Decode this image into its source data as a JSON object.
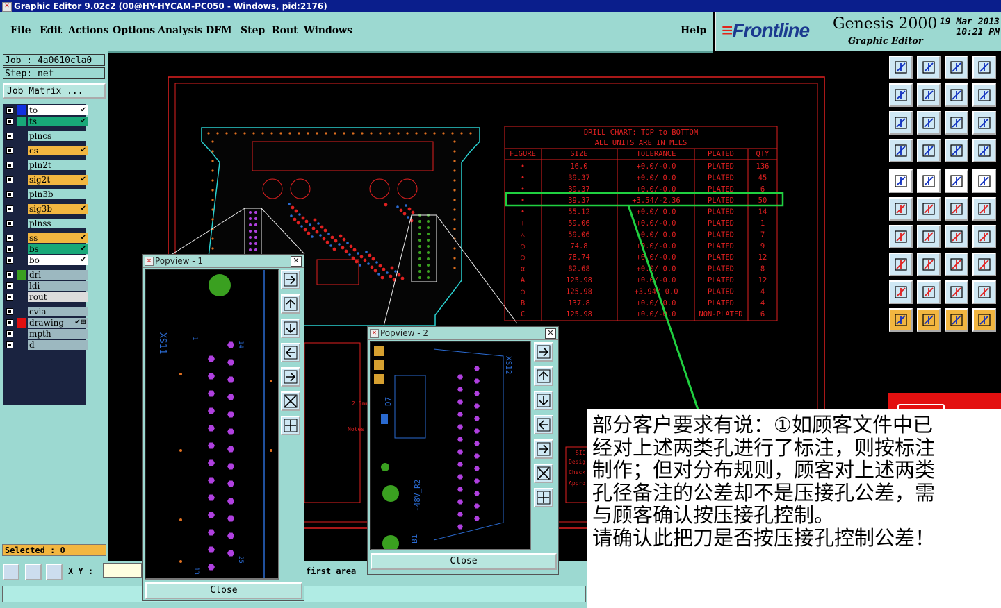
{
  "window": {
    "title": "Graphic Editor 9.02c2 (00@HY-HYCAM-PC050 - Windows, pid:2176)"
  },
  "menu": {
    "items": [
      "File",
      "Edit",
      "Actions",
      "Options",
      "Analysis",
      "DFM",
      "Step",
      "Rout",
      "Windows"
    ],
    "help": "Help"
  },
  "brand": {
    "logo": "Frontline",
    "product": "Genesis 2000",
    "subtitle": "Graphic Editor",
    "date": "19 Mar 2013",
    "time": "10:21 PM"
  },
  "job": {
    "job_label": "Job : 4a0610cla0",
    "step_label": "Step: net",
    "matrix_button": "Job Matrix ..."
  },
  "layers": [
    {
      "name": "to",
      "swatch": "#1030e0",
      "bg": "#ffffff",
      "mark": "✔"
    },
    {
      "name": "ts",
      "swatch": "#18a878",
      "bg": "#18a878",
      "mark": "✔"
    },
    {
      "name": "plncs",
      "swatch": "",
      "bg": "#9cd9d1",
      "mark": ""
    },
    {
      "name": "cs",
      "swatch": "",
      "bg": "#f2b640",
      "mark": "✔"
    },
    {
      "name": "pln2t",
      "swatch": "",
      "bg": "#9cd9d1",
      "mark": ""
    },
    {
      "name": "sig2t",
      "swatch": "",
      "bg": "#f2b640",
      "mark": "✔"
    },
    {
      "name": "pln3b",
      "swatch": "",
      "bg": "#9cd9d1",
      "mark": ""
    },
    {
      "name": "sig3b",
      "swatch": "",
      "bg": "#f2b640",
      "mark": "✔"
    },
    {
      "name": "plnss",
      "swatch": "",
      "bg": "#9cd9d1",
      "mark": ""
    },
    {
      "name": "ss",
      "swatch": "",
      "bg": "#f2b640",
      "mark": "✔"
    },
    {
      "name": "bs",
      "swatch": "",
      "bg": "#18a878",
      "mark": "✔"
    },
    {
      "name": "bo",
      "swatch": "",
      "bg": "#ffffff",
      "mark": "✔"
    },
    {
      "name": "drl",
      "swatch": "#3aa020",
      "bg": "#9cb8c0",
      "mark": ""
    },
    {
      "name": "ldi",
      "swatch": "",
      "bg": "#9cb8c0",
      "mark": ""
    },
    {
      "name": "rout",
      "swatch": "",
      "bg": "#dcdcdc",
      "mark": ""
    },
    {
      "name": "cvia",
      "swatch": "",
      "bg": "#9cb8c0",
      "mark": ""
    },
    {
      "name": "drawing",
      "swatch": "#e01010",
      "bg": "#9cb8c0",
      "mark": "✔⊞"
    },
    {
      "name": "mpth",
      "swatch": "",
      "bg": "#9cb8c0",
      "mark": ""
    },
    {
      "name": "d",
      "swatch": "",
      "bg": "#9cb8c0",
      "mark": ""
    }
  ],
  "selected": "Selected : 0",
  "bottom": {
    "xy_label": "X Y :",
    "message": "first area"
  },
  "drill_chart": {
    "title": "DRILL CHART: TOP to BOTTOM",
    "subtitle": "ALL UNITS ARE IN MILS",
    "headers": [
      "FIGURE",
      "SIZE",
      "TOLERANCE",
      "PLATED",
      "QTY"
    ],
    "rows": [
      [
        "•",
        "16.0",
        "+0.0/-0.0",
        "PLATED",
        "136"
      ],
      [
        "•",
        "39.37",
        "+0.0/-0.0",
        "PLATED",
        "45"
      ],
      [
        "•",
        "39.37",
        "+0.0/-0.0",
        "PLATED",
        "6"
      ],
      [
        "•",
        "39.37",
        "+3.54/-2.36",
        "PLATED",
        "50"
      ],
      [
        "•",
        "55.12",
        "+0.0/-0.0",
        "PLATED",
        "14"
      ],
      [
        "+",
        "59.06",
        "+0.0/-0.0",
        "PLATED",
        "1"
      ],
      [
        "△",
        "59.06",
        "+0.0/-0.0",
        "PLATED",
        "7"
      ],
      [
        "○",
        "74.8",
        "+0.0/-0.0",
        "PLATED",
        "9"
      ],
      [
        "○",
        "78.74",
        "+0.0/-0.0",
        "PLATED",
        "12"
      ],
      [
        "α",
        "82.68",
        "+0.0/-0.0",
        "PLATED",
        "8"
      ],
      [
        "A",
        "125.98",
        "+0.0/-0.0",
        "PLATED",
        "12"
      ],
      [
        "○",
        "125.98",
        "+3.94/-0.0",
        "PLATED",
        "4"
      ],
      [
        "B",
        "137.8",
        "+0.0/-0.0",
        "PLATED",
        "4"
      ],
      [
        "C",
        "125.98",
        "+0.0/-0.0",
        "NON-PLATED",
        "6"
      ]
    ]
  },
  "board_labels": {
    "notes": "Notes",
    "dim": "2.5mm",
    "sig": "SIG",
    "design": "Desig",
    "check": "Check",
    "appro": "Appro"
  },
  "popup1": {
    "title": "Popview - 1",
    "close": "Close",
    "ref": "XS11",
    "pin_a": "1",
    "pin_b": "14",
    "pin_c": "13",
    "pin_d": "25"
  },
  "popup2": {
    "title": "Popview - 2",
    "close": "Close",
    "ref": "XS12",
    "d7": "D7",
    "r2": "-48V_R2",
    "b1": "B1"
  },
  "note": "部分客户要求有说：①如顾客文件中已\n经对上述两类孔进行了标注，则按标注\n制作；但对分布规则，顾客对上述两类\n孔径备注的公差却不是压接孔公差，需\n与顾客确认按压接孔控制。\n请确认此把刀是否按压接孔控制公差！",
  "colors": {
    "panel": "#9cd9d1",
    "title_bar": "#0a1e8c",
    "drill_red": "#e02020",
    "highlight_green": "#20d040"
  }
}
